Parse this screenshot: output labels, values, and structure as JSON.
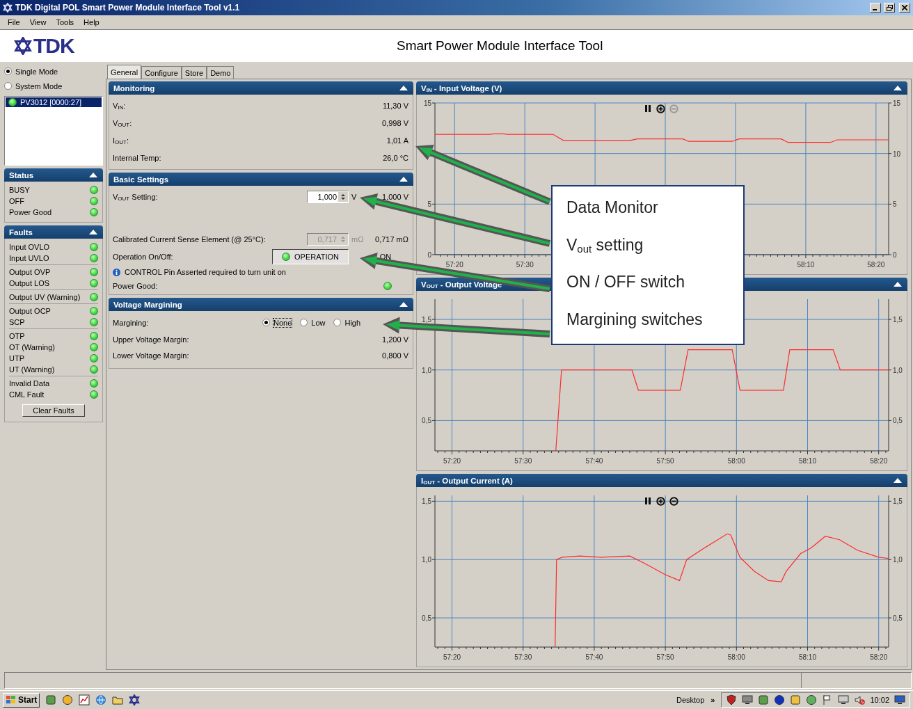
{
  "window": {
    "title": "TDK Digital POL Smart Power Module Interface Tool v1.1"
  },
  "menu": [
    "File",
    "View",
    "Tools",
    "Help"
  ],
  "header": {
    "logo": "TDK",
    "title": "Smart Power Module Interface Tool"
  },
  "modes": [
    {
      "label": "Single Mode",
      "selected": true
    },
    {
      "label": "System Mode",
      "selected": false
    }
  ],
  "devices": [
    {
      "label": "PV3012 [0000:27]",
      "selected": true
    }
  ],
  "status": {
    "title": "Status",
    "items": [
      "BUSY",
      "OFF",
      "Power Good"
    ]
  },
  "faults": {
    "title": "Faults",
    "groups": [
      [
        "Input OVLO",
        "Input UVLO"
      ],
      [
        "Output OVP",
        "Output LOS"
      ],
      [
        "Output UV (Warning)"
      ],
      [
        "Output OCP",
        "SCP"
      ],
      [
        "OTP",
        "OT (Warning)",
        "UTP",
        "UT (Warning)"
      ],
      [
        "Invalid Data",
        "CML Fault"
      ]
    ],
    "button": "Clear Faults"
  },
  "tabs": [
    {
      "label": "General",
      "selected": true
    },
    {
      "label": "Configure",
      "selected": false
    },
    {
      "label": "Store",
      "selected": false
    },
    {
      "label": "Demo",
      "selected": false
    }
  ],
  "monitoring": {
    "title": "Monitoring",
    "rows": [
      {
        "label": "V$_{IN}$:",
        "value": "11,30 V"
      },
      {
        "label": "V$_{OUT}$:",
        "value": "0,998 V"
      },
      {
        "label": "I$_{OUT}$:",
        "value": "1,01 A"
      },
      {
        "label": "Internal Temp:",
        "value": "26,0 °C"
      }
    ]
  },
  "basic_settings": {
    "title": "Basic Settings",
    "rows": [
      {
        "kind": "spin",
        "label": "V$_{OUT}$ Setting:",
        "value": "1,000",
        "disabled": false,
        "unit": "V",
        "reading": "1,000 V"
      },
      {
        "kind": "spin",
        "label": "Calibrated Current Sense Element (@ 25°C):",
        "value": "0,717",
        "disabled": true,
        "unit": "mΩ",
        "reading": "0,717 mΩ"
      },
      {
        "kind": "toggle",
        "label": "Operation On/Off:",
        "button": "OPERATION",
        "reading": "ON"
      },
      {
        "kind": "info",
        "text": "CONTROL Pin Asserted required to turn unit on"
      },
      {
        "kind": "led",
        "label": "Power Good:"
      }
    ]
  },
  "voltage_margining": {
    "title": "Voltage Margining",
    "label": "Margining:",
    "options": [
      {
        "label": "None",
        "selected": true,
        "focused": true
      },
      {
        "label": "Low",
        "selected": false,
        "focused": false
      },
      {
        "label": "High",
        "selected": false,
        "focused": false
      }
    ],
    "rows": [
      {
        "label": "Upper Voltage Margin:",
        "value": "1,200 V"
      },
      {
        "label": "Lower Voltage Margin:",
        "value": "0,800 V"
      }
    ]
  },
  "charts": [
    {
      "title": "V$_{IN}$ - Input Voltage (V)",
      "controls": [
        {
          "kind": "pause",
          "disabled": false
        },
        {
          "kind": "zoom_in",
          "disabled": false
        },
        {
          "kind": "zoom_out",
          "disabled": true
        }
      ],
      "chart_data": {
        "type": "line",
        "grid": true,
        "xlim": [
          3437.2,
          3501.8
        ],
        "ylim": [
          0,
          15
        ],
        "y2lim": [
          0,
          15
        ],
        "xticks": [
          {
            "value": 3440,
            "label": "57:20"
          },
          {
            "value": 3450,
            "label": "57:30"
          },
          {
            "value": 3490,
            "label": "58:10"
          },
          {
            "value": 3500,
            "label": "58:20"
          }
        ],
        "yticks": [
          0,
          5,
          10,
          15
        ],
        "y2ticks": [
          0,
          5,
          10,
          15
        ],
        "x": [
          3437.2,
          3445,
          3445.5,
          3447,
          3447.5,
          3454,
          3455.5,
          3465,
          3466,
          3472.5,
          3473.3,
          3479.5,
          3480.5,
          3486.5,
          3487.5,
          3493.5,
          3494.5,
          3501.8
        ],
        "series": [
          {
            "color": "#ff2a2a",
            "values": [
              11.9,
              11.9,
              11.95,
              11.95,
              11.9,
              11.9,
              11.3,
              11.3,
              11.45,
              11.45,
              11.2,
              11.2,
              11.45,
              11.45,
              11.1,
              11.1,
              11.35,
              11.35
            ]
          }
        ]
      }
    },
    {
      "title": "V$_{OUT}$ - Output Voltage",
      "chart_data": {
        "type": "line",
        "grid": true,
        "xlim": [
          3437.6,
          3501.4
        ],
        "ylim": [
          0.2,
          1.7
        ],
        "y2lim": [
          0.2,
          1.7
        ],
        "xticks": [
          {
            "value": 3440,
            "label": "57:20"
          },
          {
            "value": 3450,
            "label": "57:30"
          },
          {
            "value": 3460,
            "label": "57:40"
          },
          {
            "value": 3470,
            "label": "57:50"
          },
          {
            "value": 3480,
            "label": "58:00"
          },
          {
            "value": 3490,
            "label": "58:10"
          },
          {
            "value": 3500,
            "label": "58:20"
          }
        ],
        "yticks": [
          {
            "value": 0.5,
            "label": "0,5"
          },
          {
            "value": 1.0,
            "label": "1,0"
          },
          {
            "value": 1.5,
            "label": "1,5"
          }
        ],
        "y2ticks": [
          {
            "value": 0.5,
            "label": "0,5"
          },
          {
            "value": 1.0,
            "label": "1,0"
          },
          {
            "value": 1.5,
            "label": "1,5"
          }
        ],
        "x": [
          3454.6,
          3455.4,
          3465.3,
          3466.2,
          3472.1,
          3473.2,
          3479.4,
          3480.5,
          3486.6,
          3487.5,
          3493.6,
          3494.6,
          3501.4
        ],
        "series": [
          {
            "color": "#ff2a2a",
            "values": [
              0.2,
              1.0,
              1.0,
              0.8,
              0.8,
              1.2,
              1.2,
              0.8,
              0.8,
              1.2,
              1.2,
              1.0,
              1.0
            ]
          }
        ]
      }
    },
    {
      "title": "I$_{OUT}$ - Output Current (A)",
      "controls": [
        {
          "kind": "pause",
          "disabled": false
        },
        {
          "kind": "zoom_in",
          "disabled": false
        },
        {
          "kind": "zoom_out",
          "disabled": false
        }
      ],
      "chart_data": {
        "type": "line",
        "grid": true,
        "xlim": [
          3437.6,
          3501.4
        ],
        "ylim": [
          0.25,
          1.55
        ],
        "y2lim": [
          0.25,
          1.55
        ],
        "xticks": [
          {
            "value": 3440,
            "label": "57:20"
          },
          {
            "value": 3450,
            "label": "57:30"
          },
          {
            "value": 3460,
            "label": "57:40"
          },
          {
            "value": 3470,
            "label": "57:50"
          },
          {
            "value": 3480,
            "label": "58:00"
          },
          {
            "value": 3490,
            "label": "58:10"
          },
          {
            "value": 3500,
            "label": "58:20"
          }
        ],
        "yticks": [
          {
            "value": 0.5,
            "label": "0,5"
          },
          {
            "value": 1.0,
            "label": "1,0"
          },
          {
            "value": 1.5,
            "label": "1,5"
          }
        ],
        "y2ticks": [
          {
            "value": 0.5,
            "label": "0,5"
          },
          {
            "value": 1.0,
            "label": "1,0"
          },
          {
            "value": 1.5,
            "label": "1,5"
          }
        ],
        "x": [
          3454.5,
          3454.7,
          3455.5,
          3458,
          3461,
          3465,
          3467,
          3470,
          3472,
          3473,
          3475.5,
          3478.7,
          3479.2,
          3480.5,
          3482.5,
          3484.5,
          3486.3,
          3487,
          3489,
          3490.5,
          3492.5,
          3494.5,
          3497,
          3500,
          3501.4
        ],
        "series": [
          {
            "color": "#ff2a2a",
            "values": [
              0.25,
              1.0,
              1.02,
              1.03,
              1.02,
              1.03,
              0.97,
              0.87,
              0.82,
              1.0,
              1.1,
              1.22,
              1.21,
              1.02,
              0.9,
              0.82,
              0.81,
              0.9,
              1.05,
              1.1,
              1.2,
              1.17,
              1.08,
              1.02,
              1.01
            ]
          }
        ]
      }
    }
  ],
  "callout": {
    "items": [
      "Data Monitor",
      "V$_{out}$ setting",
      "ON / OFF switch",
      "Margining switches"
    ]
  },
  "taskbar": {
    "start": "Start",
    "desktop": "Desktop",
    "chevron": "»",
    "clock": "10:02"
  }
}
